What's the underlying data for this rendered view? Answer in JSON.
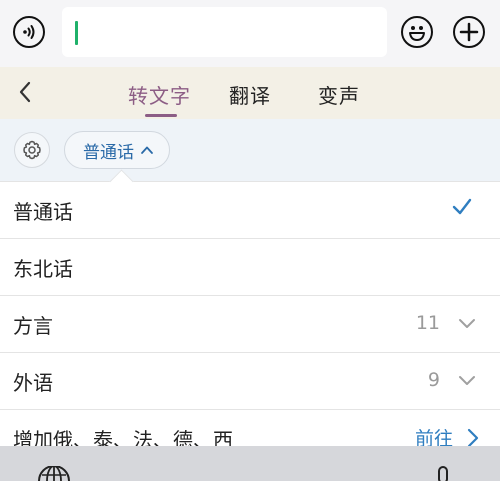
{
  "tabs": {
    "transcribe": "转文字",
    "translate": "翻译",
    "voice_change": "变声"
  },
  "language_selector": {
    "current": "普通话"
  },
  "language_list": [
    {
      "label": "普通话",
      "selected": true
    },
    {
      "label": "东北话"
    },
    {
      "label": "方言",
      "count": "11"
    },
    {
      "label": "外语",
      "count": "9"
    },
    {
      "label": "增加俄、泰、法、德、西",
      "action": "前往"
    }
  ],
  "colors": {
    "accent_tab": "#8c5d85",
    "link_blue": "#2f7ec0",
    "caret_green": "#1fb16a"
  }
}
